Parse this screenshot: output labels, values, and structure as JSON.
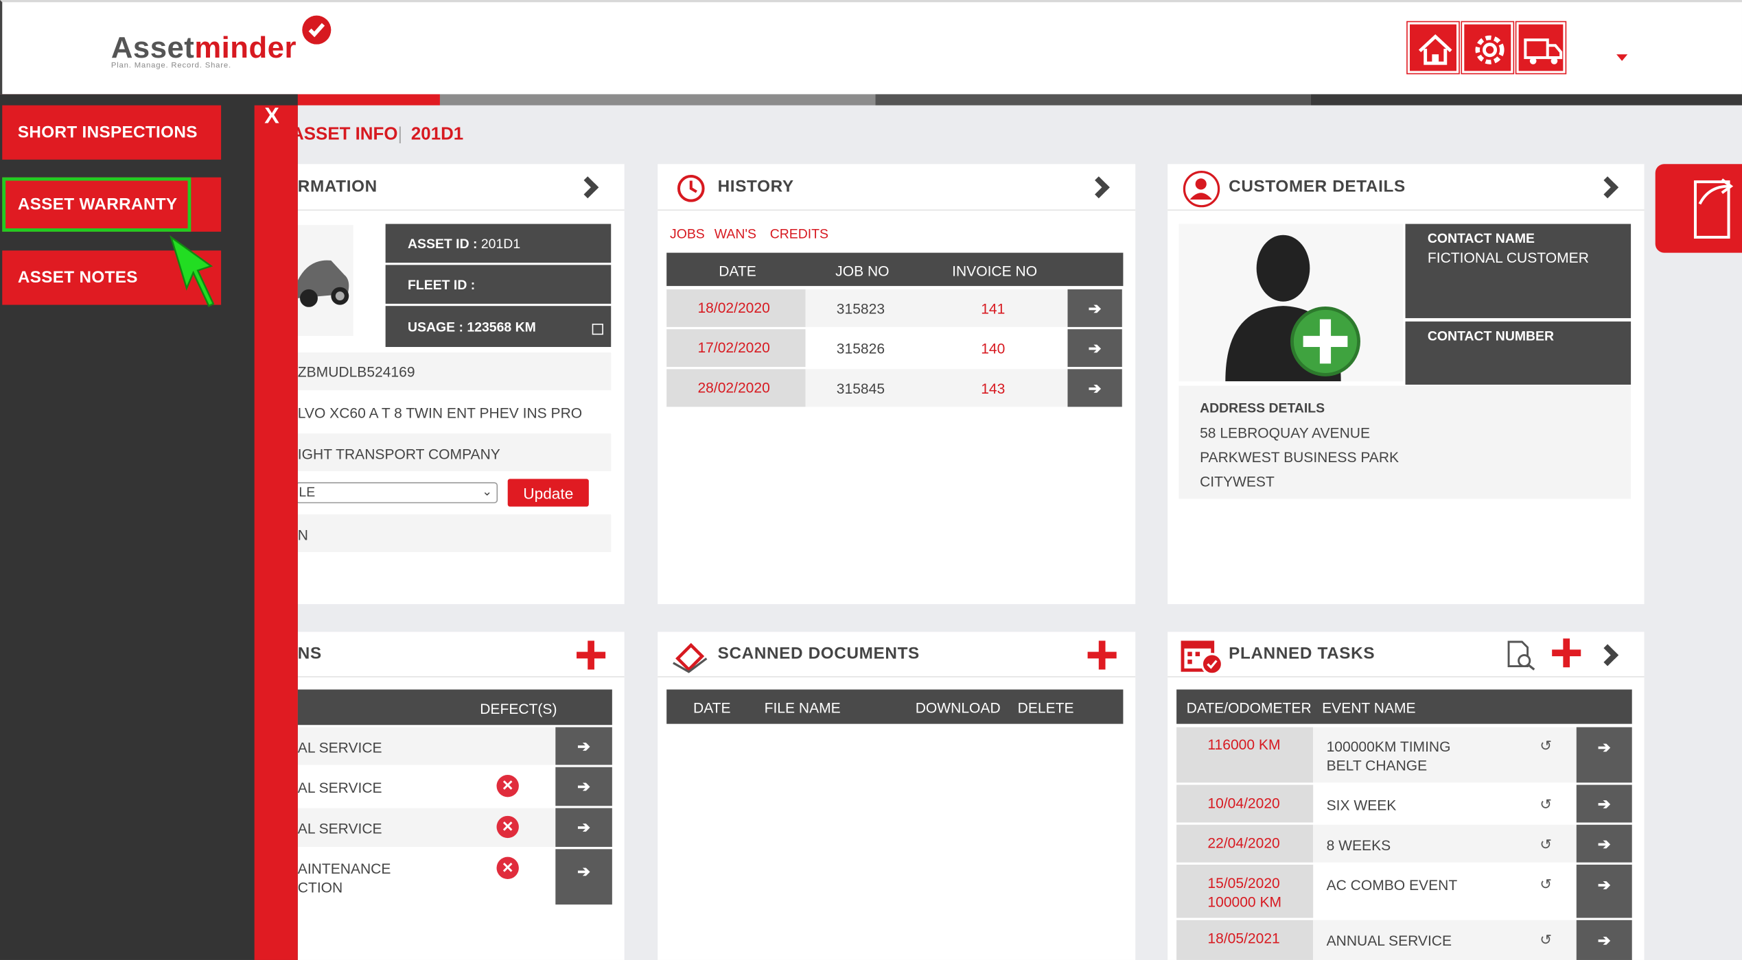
{
  "header": {
    "logo_main": "Asset",
    "logo_accent": "minder",
    "logo_tagline": "Plan. Manage. Record. Share.",
    "nav_icons": [
      "home-icon",
      "gear-icon",
      "truck-icon"
    ],
    "brand_color": "#e01b22"
  },
  "breadcrumb": {
    "section": "ASSET INFO",
    "asset": "201D1"
  },
  "sidebar": {
    "close_label": "X",
    "items": [
      {
        "label": "SHORT INSPECTIONS"
      },
      {
        "label": "ASSET WARRANTY",
        "highlighted": true
      },
      {
        "label": "ASSET NOTES"
      }
    ]
  },
  "asset_info": {
    "title": "RMATION",
    "asset_id_label": "ASSET ID :",
    "asset_id": "201D1",
    "fleet_id_label": "FLEET ID :",
    "fleet_id": "",
    "usage_label": "USAGE :",
    "usage": "123568 KM",
    "vin": "ZBMUDLB524169",
    "model": "LVO XC60 A T 8 TWIN ENT PHEV INS PRO",
    "company": "IGHT TRANSPORT COMPANY",
    "status_value": "LE",
    "update_label": "Update",
    "last_row": "N"
  },
  "history": {
    "title": "HISTORY",
    "tabs": [
      "JOBS",
      "WAN'S",
      "CREDITS"
    ],
    "columns": [
      "DATE",
      "JOB NO",
      "INVOICE NO"
    ],
    "rows": [
      {
        "date": "18/02/2020",
        "job": "315823",
        "invoice": "141"
      },
      {
        "date": "17/02/2020",
        "job": "315826",
        "invoice": "140"
      },
      {
        "date": "28/02/2020",
        "job": "315845",
        "invoice": "143"
      }
    ]
  },
  "customer": {
    "title": "CUSTOMER DETAILS",
    "contact_name_label": "CONTACT NAME",
    "contact_name": "FICTIONAL CUSTOMER",
    "contact_number_label": "CONTACT NUMBER",
    "contact_number": "",
    "address_label": "ADDRESS DETAILS",
    "address": [
      "58 LEBROQUAY AVENUE",
      "PARKWEST BUSINESS PARK",
      "CITYWEST"
    ]
  },
  "inspections": {
    "title": "NS",
    "column": "DEFECT(S)",
    "rows": [
      {
        "line1": "AL SERVICE",
        "line2": "",
        "defect": false
      },
      {
        "line1": "AL SERVICE",
        "line2": "",
        "defect": true
      },
      {
        "line1": "AL SERVICE",
        "line2": "",
        "defect": true
      },
      {
        "line1": "AINTENANCE",
        "line2": "CTION",
        "defect": true
      }
    ]
  },
  "scanned": {
    "title": "SCANNED DOCUMENTS",
    "columns": [
      "DATE",
      "FILE NAME",
      "DOWNLOAD",
      "DELETE"
    ]
  },
  "planned": {
    "title": "PLANNED TASKS",
    "columns": [
      "DATE/ODOMETER",
      "EVENT NAME"
    ],
    "rows": [
      {
        "date": "116000 KM",
        "date2": "",
        "event": "100000KM TIMING",
        "event2": "BELT CHANGE"
      },
      {
        "date": "10/04/2020",
        "date2": "",
        "event": "SIX WEEK",
        "event2": ""
      },
      {
        "date": "22/04/2020",
        "date2": "",
        "event": "8 WEEKS",
        "event2": ""
      },
      {
        "date": "15/05/2020",
        "date2": "100000 KM",
        "event": "AC COMBO EVENT",
        "event2": ""
      },
      {
        "date": "18/05/2021",
        "date2": "",
        "event": "ANNUAL SERVICE",
        "event2": ""
      }
    ]
  }
}
